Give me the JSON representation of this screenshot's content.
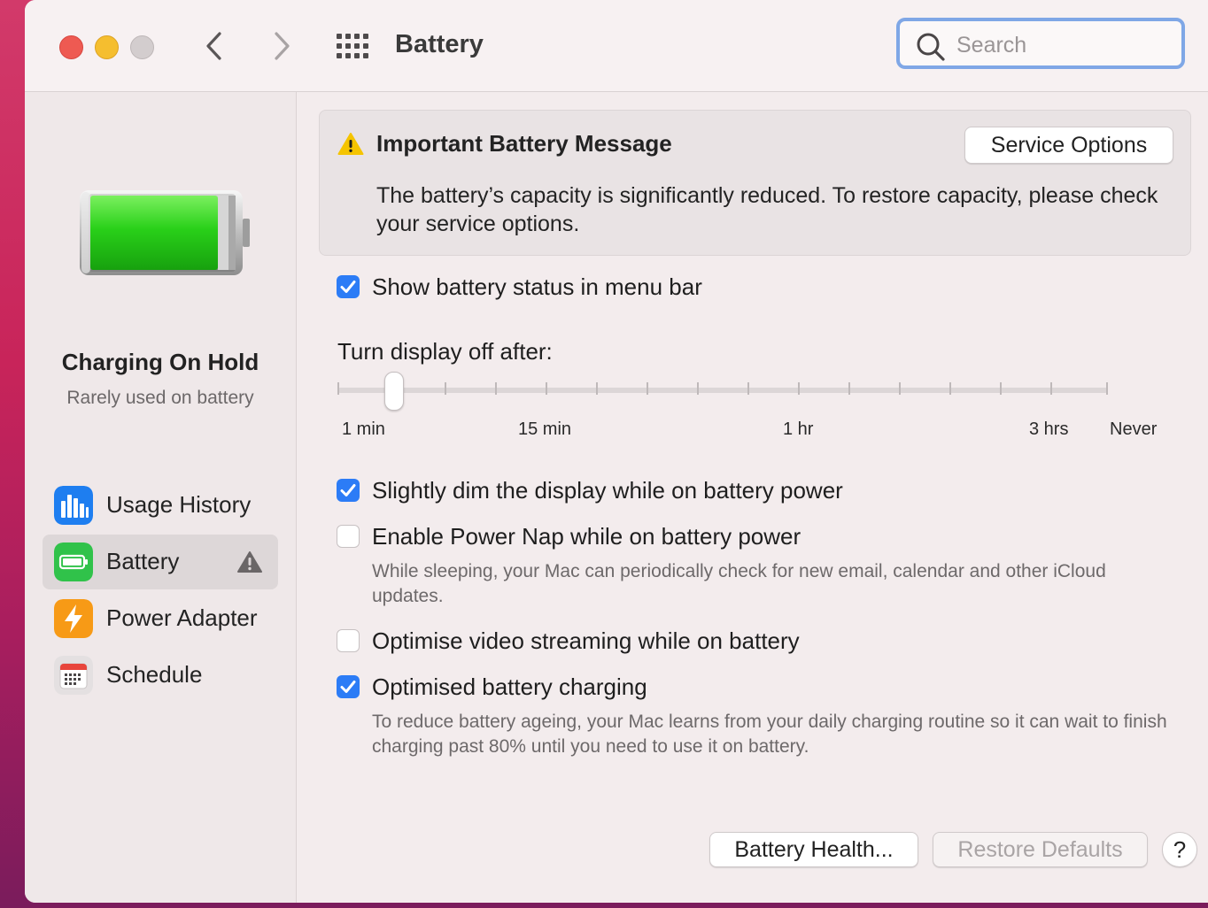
{
  "window": {
    "title": "Battery",
    "search_placeholder": "Search"
  },
  "sidebar": {
    "status_title": "Charging On Hold",
    "status_subtitle": "Rarely used on battery",
    "items": [
      {
        "label": "Usage History",
        "icon": "bar-chart-icon"
      },
      {
        "label": "Battery",
        "icon": "battery-icon",
        "active": true,
        "warning": true
      },
      {
        "label": "Power Adapter",
        "icon": "lightning-icon"
      },
      {
        "label": "Schedule",
        "icon": "calendar-icon"
      }
    ]
  },
  "message": {
    "title": "Important Battery Message",
    "body": "The battery’s capacity is significantly reduced. To restore capacity, please check your service options.",
    "button": "Service Options"
  },
  "options": {
    "show_status": {
      "label": "Show battery status in menu bar",
      "checked": true
    },
    "dim_display": {
      "label": "Slightly dim the display while on battery power",
      "checked": true
    },
    "power_nap": {
      "label": "Enable Power Nap while on battery power",
      "checked": false,
      "help": "While sleeping, your Mac can periodically check for new email, calendar and other iCloud updates."
    },
    "video_streaming": {
      "label": "Optimise video streaming while on battery",
      "checked": false
    },
    "optimised_charging": {
      "label": "Optimised battery charging",
      "checked": true,
      "help": "To reduce battery ageing, your Mac learns from your daily charging routine so it can wait to finish charging past 80% until you need to use it on battery."
    }
  },
  "slider": {
    "label": "Turn display off after:",
    "ticks": [
      "1 min",
      "15 min",
      "1 hr",
      "3 hrs",
      "Never"
    ],
    "value": "1 min"
  },
  "footer": {
    "health_button": "Battery Health...",
    "restore_button": "Restore Defaults",
    "help_button": "?"
  },
  "colors": {
    "accent": "#2c7cf6",
    "battery_green": "#29d019",
    "warning": "#f5c400"
  }
}
